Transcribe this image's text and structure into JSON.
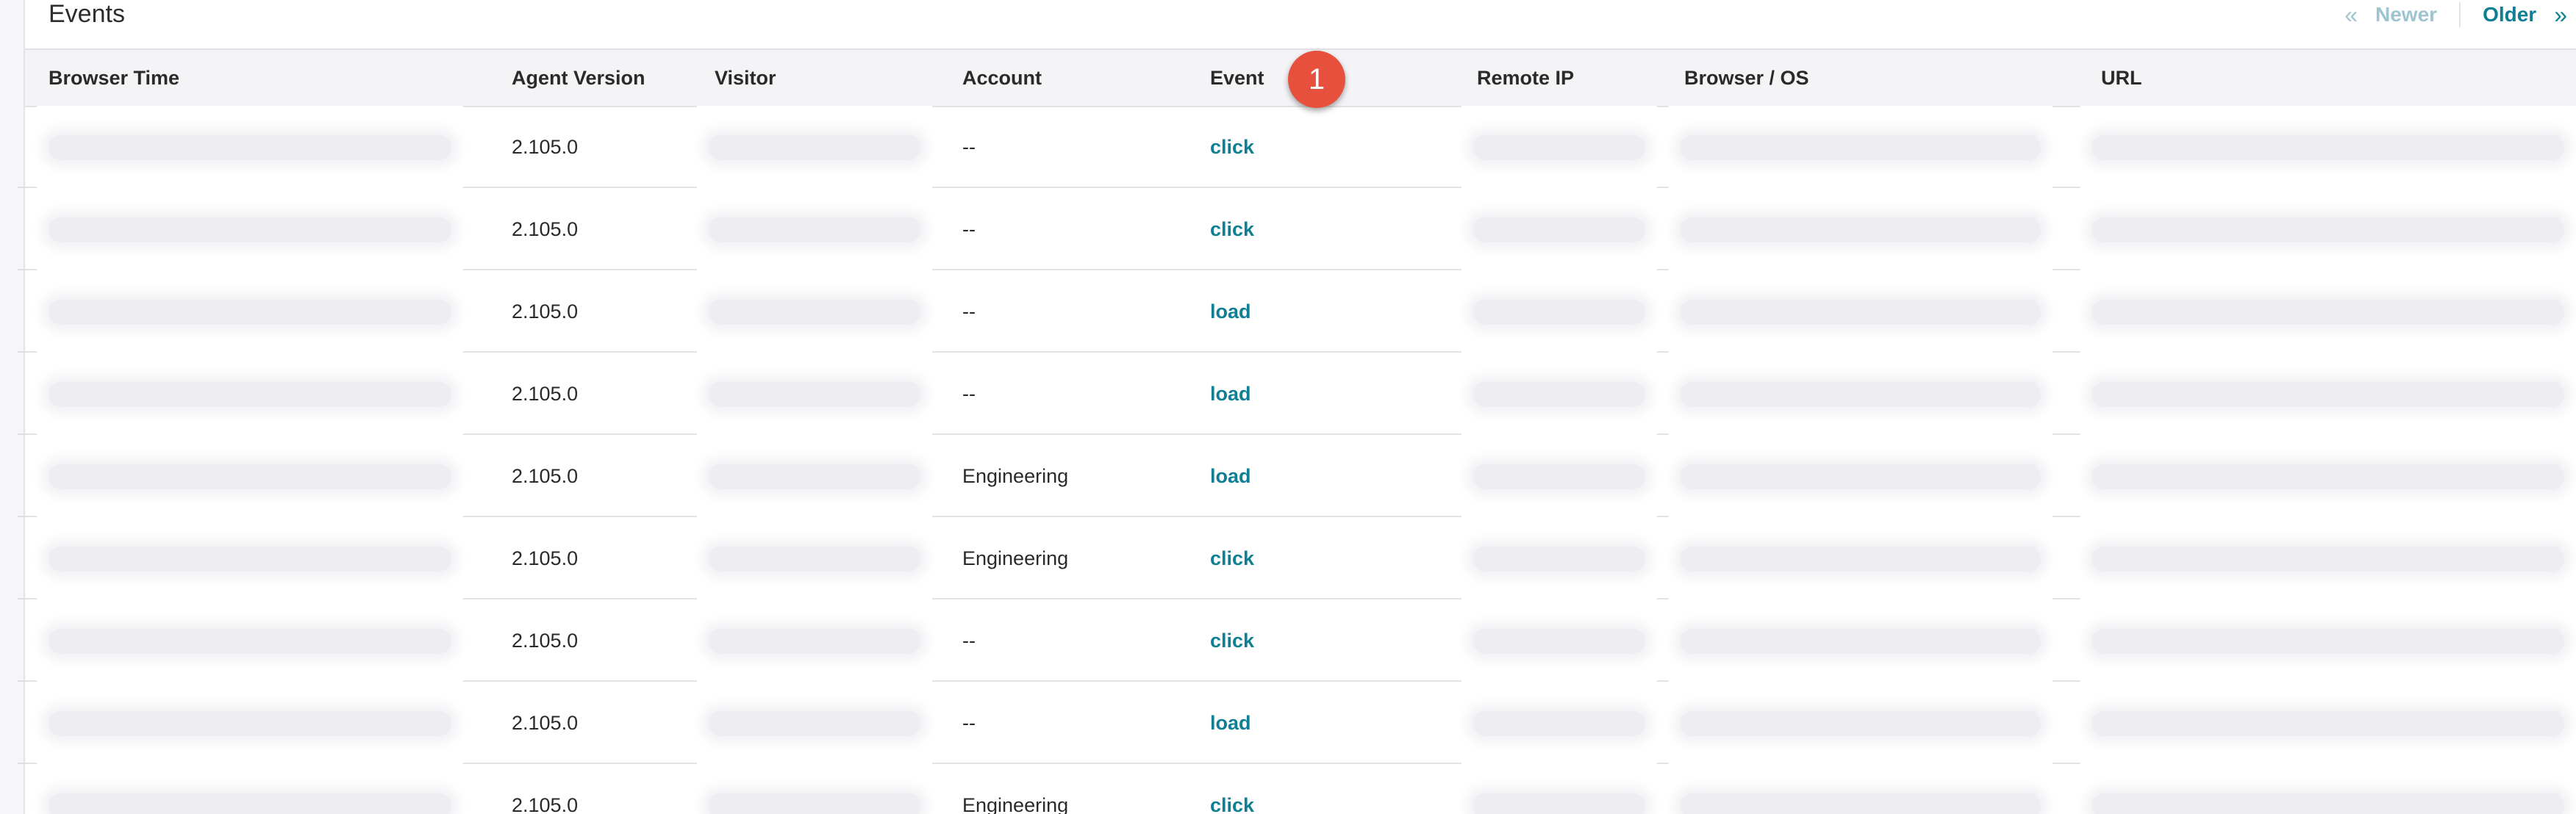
{
  "panel": {
    "title": "Events",
    "pager": {
      "newer_label": "Newer",
      "older_label": "Older",
      "newer_icon": "double-chevron-left-icon",
      "older_icon": "double-chevron-right-icon"
    }
  },
  "table": {
    "headers": {
      "browser_time": "Browser Time",
      "agent_version": "Agent Version",
      "visitor": "Visitor",
      "account": "Account",
      "event": "Event",
      "remote_ip": "Remote IP",
      "browser_os": "Browser / OS",
      "url": "URL"
    },
    "rows": [
      {
        "agent_version": "2.105.0",
        "account": "--",
        "event": "click"
      },
      {
        "agent_version": "2.105.0",
        "account": "--",
        "event": "click"
      },
      {
        "agent_version": "2.105.0",
        "account": "--",
        "event": "load"
      },
      {
        "agent_version": "2.105.0",
        "account": "--",
        "event": "load"
      },
      {
        "agent_version": "2.105.0",
        "account": "Engineering",
        "event": "load"
      },
      {
        "agent_version": "2.105.0",
        "account": "Engineering",
        "event": "click"
      },
      {
        "agent_version": "2.105.0",
        "account": "--",
        "event": "click"
      },
      {
        "agent_version": "2.105.0",
        "account": "--",
        "event": "load"
      },
      {
        "agent_version": "2.105.0",
        "account": "Engineering",
        "event": "click"
      }
    ]
  },
  "annotation": {
    "badge_number": "1",
    "badge_color": "#e8503e"
  },
  "colors": {
    "link": "#0f7f94",
    "link_disabled": "#9ec5cf",
    "header_bg": "#f4f4f7"
  }
}
